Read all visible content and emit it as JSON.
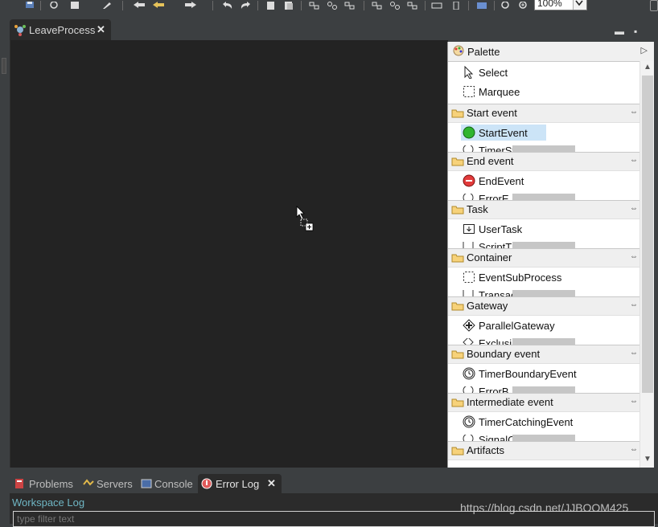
{
  "toolbar": {
    "zoom_value": "100%"
  },
  "editor": {
    "tab_label": "LeaveProcess",
    "tab_close": "✕",
    "minimize": "▬",
    "maximize": "▪"
  },
  "palette": {
    "title": "Palette",
    "tools": [
      {
        "label": "Select",
        "icon": "select-arrow-icon"
      },
      {
        "label": "Marquee",
        "icon": "marquee-icon"
      }
    ],
    "drawers": [
      {
        "label": "Start event",
        "first": "StartEvent",
        "first_icon": "start-event-icon",
        "second": "TimerSt"
      },
      {
        "label": "End event",
        "first": "EndEvent",
        "first_icon": "end-event-icon",
        "second": "ErrorE"
      },
      {
        "label": "Task",
        "first": "UserTask",
        "first_icon": "user-task-icon",
        "second": "ScriptT"
      },
      {
        "label": "Container",
        "first": "EventSubProcess",
        "first_icon": "event-subprocess-icon",
        "second": "Transac"
      },
      {
        "label": "Gateway",
        "first": "ParallelGateway",
        "first_icon": "parallel-gateway-icon",
        "second": "Exclusi"
      },
      {
        "label": "Boundary event",
        "first": "TimerBoundaryEvent",
        "first_icon": "timer-boundary-icon",
        "second": "ErrorB"
      },
      {
        "label": "Intermediate event",
        "first": "TimerCatchingEvent",
        "first_icon": "timer-catching-icon",
        "second": "SignalC"
      },
      {
        "label": "Artifacts"
      }
    ],
    "selected_item": "StartEvent"
  },
  "bottom": {
    "tabs": [
      {
        "label": "Problems",
        "icon": "problems-icon"
      },
      {
        "label": "Servers",
        "icon": "servers-icon"
      },
      {
        "label": "Console",
        "icon": "console-icon"
      },
      {
        "label": "Error Log",
        "icon": "error-log-icon",
        "active": true
      }
    ],
    "workspace_log": "Workspace Log",
    "filter_placeholder": "type filter text"
  },
  "watermark": "https://blog.csdn.net/JJBOOM425",
  "colors": {
    "canvas_bg": "#232323",
    "chrome_bg": "#3c3f41",
    "selected_bg": "#cce4f7",
    "start_green": "#2fb52f",
    "end_red": "#e23b3b",
    "link_teal": "#6fb6c4"
  }
}
